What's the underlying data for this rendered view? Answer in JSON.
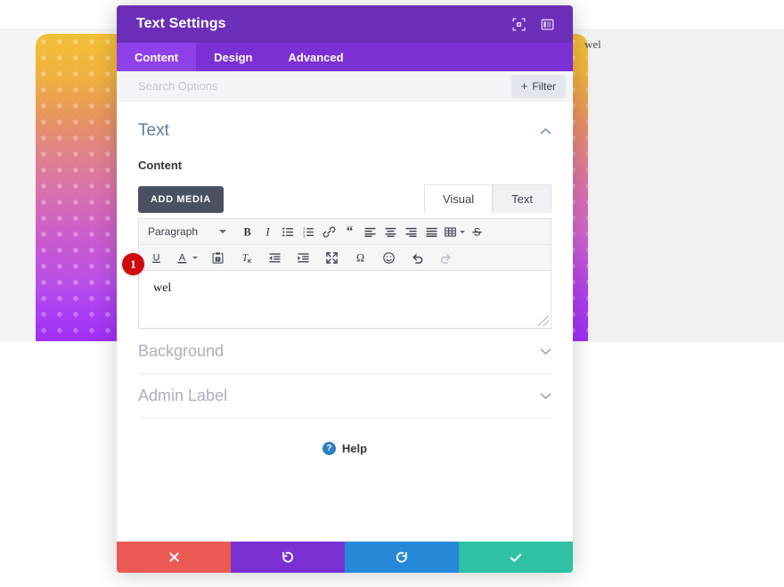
{
  "background": {
    "page_text": "wel",
    "gradient_from": "#f2c037",
    "gradient_mid": "#d96fae",
    "gradient_to": "#a02ff7"
  },
  "modal": {
    "title": "Text Settings",
    "header_icons": [
      {
        "name": "focus-mode-icon"
      },
      {
        "name": "layout-toggle-icon"
      }
    ],
    "tabs": [
      {
        "label": "Content",
        "active": true
      },
      {
        "label": "Design",
        "active": false
      },
      {
        "label": "Advanced",
        "active": false
      }
    ],
    "search": {
      "placeholder": "Search Options",
      "value": ""
    },
    "filter_button": {
      "label": "Filter",
      "plus": "+"
    },
    "text_section": {
      "title": "Text",
      "chevron": "⌃",
      "content_label": "Content",
      "add_media_label": "ADD MEDIA",
      "mode_tabs": [
        {
          "label": "Visual",
          "active": true
        },
        {
          "label": "Text",
          "active": false
        }
      ],
      "toolbar_row1": [
        {
          "name": "paragraph-format-select",
          "label": "Paragraph",
          "type": "select"
        },
        {
          "name": "bold-icon",
          "glyph": "B",
          "type": "text-b"
        },
        {
          "name": "italic-icon",
          "glyph": "I",
          "type": "text-i"
        },
        {
          "name": "bulleted-list-icon",
          "type": "ul"
        },
        {
          "name": "numbered-list-icon",
          "type": "ol"
        },
        {
          "name": "link-icon",
          "type": "link"
        },
        {
          "name": "blockquote-icon",
          "glyph": "“",
          "type": "quote"
        },
        {
          "name": "align-left-icon",
          "type": "align-left"
        },
        {
          "name": "align-center-icon",
          "type": "align-center"
        },
        {
          "name": "align-right-icon",
          "type": "align-right"
        },
        {
          "name": "align-justify-icon",
          "type": "align-justify"
        },
        {
          "name": "table-icon",
          "type": "table"
        },
        {
          "name": "strikethrough-icon",
          "glyph": "S",
          "type": "strike"
        }
      ],
      "toolbar_row2": [
        {
          "name": "underline-icon",
          "glyph": "U",
          "type": "underline"
        },
        {
          "name": "text-color-icon",
          "glyph": "A",
          "type": "textcolor"
        },
        {
          "name": "paste-as-text-icon",
          "type": "paste"
        },
        {
          "name": "clear-formatting-icon",
          "type": "clearfmt"
        },
        {
          "name": "outdent-icon",
          "type": "outdent"
        },
        {
          "name": "indent-icon",
          "type": "indent"
        },
        {
          "name": "fullscreen-icon",
          "type": "fullscreen"
        },
        {
          "name": "special-character-icon",
          "glyph": "Ω",
          "type": "omega"
        },
        {
          "name": "emoji-icon",
          "type": "smiley"
        },
        {
          "name": "undo-icon",
          "type": "undo"
        },
        {
          "name": "redo-icon",
          "type": "redo",
          "disabled": true
        }
      ],
      "editor_value": "wel",
      "annotation_badge": "1"
    },
    "collapsed_sections": [
      {
        "title": "Background",
        "chevron": "⌄"
      },
      {
        "title": "Admin Label",
        "chevron": "⌄"
      }
    ],
    "help": {
      "label": "Help",
      "icon_glyph": "?"
    },
    "footer_buttons": [
      {
        "name": "cancel-button",
        "icon": "close-icon",
        "color": "#ea5a53"
      },
      {
        "name": "undo-button",
        "icon": "undo-icon",
        "color": "#7B30D4"
      },
      {
        "name": "redo-button",
        "icon": "redo-icon",
        "color": "#2688d8"
      },
      {
        "name": "save-button",
        "icon": "check-icon",
        "color": "#2ec1a4"
      }
    ]
  }
}
